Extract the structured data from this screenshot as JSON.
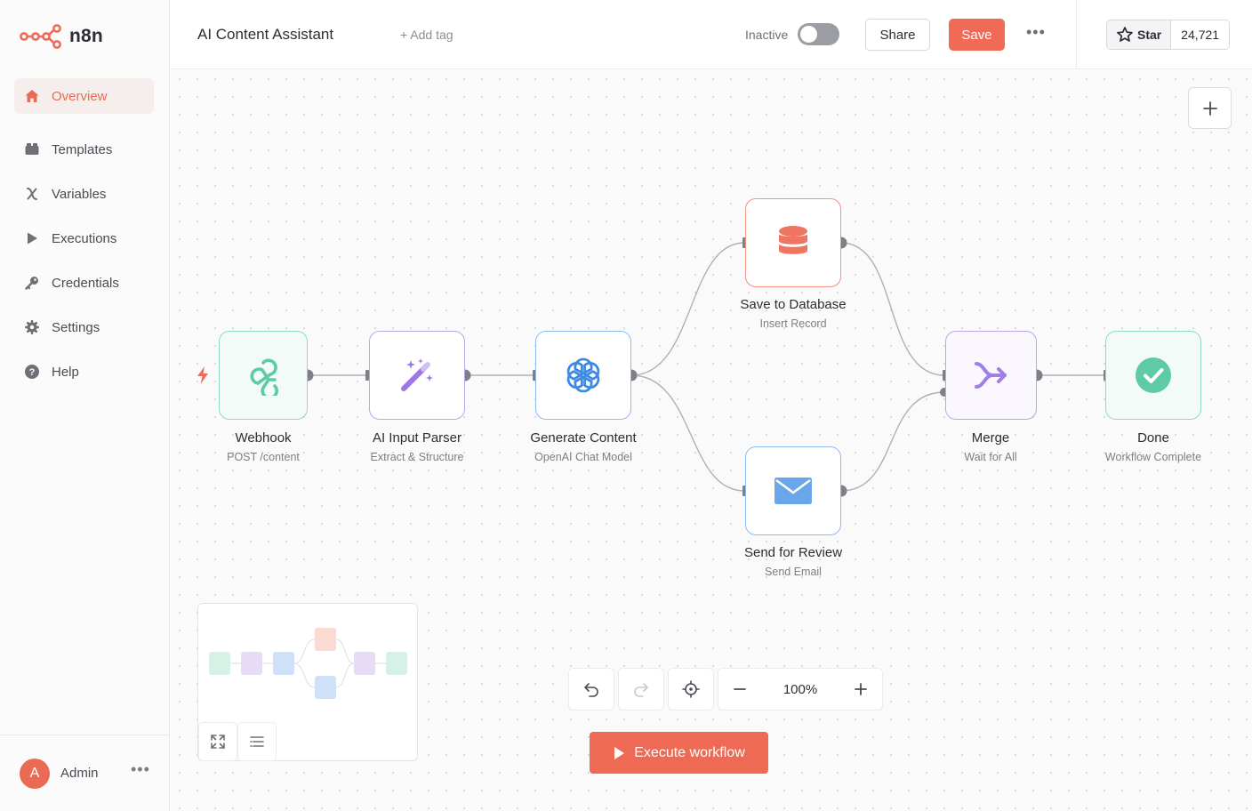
{
  "app": {
    "logo_text": "n8n"
  },
  "sidebar": {
    "items": [
      {
        "label": "Overview",
        "icon": "home-icon",
        "active": true
      },
      {
        "label": "Templates",
        "icon": "templates-icon"
      },
      {
        "label": "Variables",
        "icon": "variable-icon"
      },
      {
        "label": "Executions",
        "icon": "play-icon"
      },
      {
        "label": "Credentials",
        "icon": "key-icon"
      },
      {
        "label": "Settings",
        "icon": "gear-icon"
      },
      {
        "label": "Help",
        "icon": "help-icon"
      }
    ],
    "user": {
      "initial": "A",
      "name": "Admin",
      "more": "•••"
    }
  },
  "header": {
    "workflow_title": "AI Content Assistant",
    "add_tag": "+ Add tag",
    "status_label": "Inactive",
    "share_label": "Share",
    "save_label": "Save",
    "more": "•••",
    "star_label": "Star",
    "star_count": "24,721"
  },
  "workflow": {
    "nodes": [
      {
        "id": "webhook",
        "label": "Webhook",
        "sub": "POST /content",
        "icon": "webhook-icon",
        "color": "#5fcaa6"
      },
      {
        "id": "parser",
        "label": "AI Input Parser",
        "sub": "Extract & Structure",
        "icon": "magic-wand-icon",
        "color": "#a78ce6"
      },
      {
        "id": "generate",
        "label": "Generate Content",
        "sub": "OpenAI Chat Model",
        "icon": "openai-icon",
        "color": "#6aa6ea"
      },
      {
        "id": "database",
        "label": "Save to Database",
        "sub": "Insert Record",
        "icon": "database-icon",
        "color": "#f07560"
      },
      {
        "id": "review",
        "label": "Send for Review",
        "sub": "Send Email",
        "icon": "envelope-icon",
        "color": "#6aa6ea"
      },
      {
        "id": "merge",
        "label": "Merge",
        "sub": "Wait for All",
        "icon": "merge-icon",
        "color": "#a78ce6"
      },
      {
        "id": "done",
        "label": "Done",
        "sub": "Workflow Complete",
        "icon": "check-circle-icon",
        "color": "#5fcaa6"
      }
    ]
  },
  "canvas": {
    "zoom_level": "100%",
    "execute_label": "Execute workflow"
  },
  "colors": {
    "accent": "#ee6a55",
    "active_bg": "#f6eeec"
  }
}
